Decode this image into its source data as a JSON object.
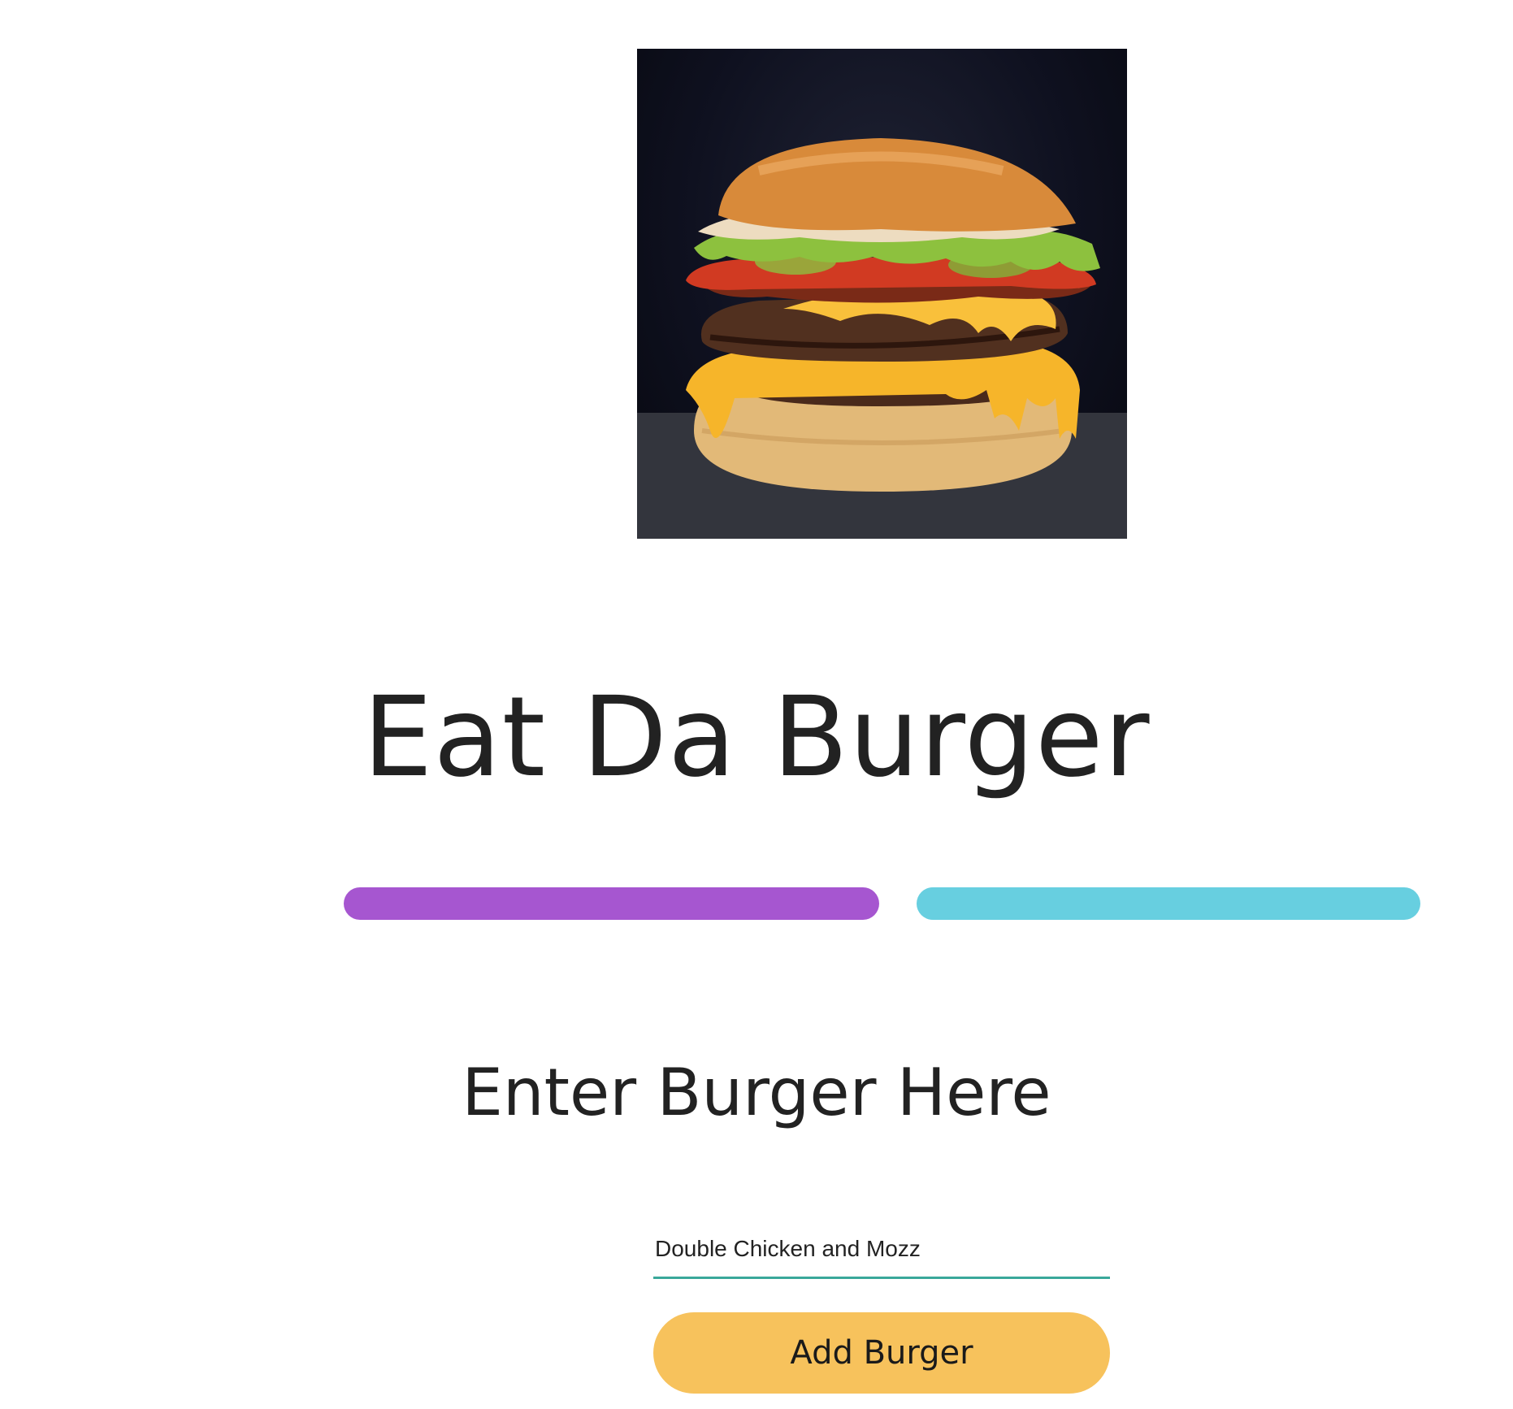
{
  "hero": {
    "image_subject": "cheeseburger"
  },
  "title": "Eat Da Burger",
  "subtitle": "Enter Burger Here",
  "form": {
    "input_value": "Double Chicken and Mozz",
    "button_label": "Add Burger"
  },
  "colors": {
    "bar_left": "#a656d0",
    "bar_right": "#67cfe0",
    "input_underline": "#3aa89a",
    "button_bg": "#f7c25c",
    "text": "#222222"
  }
}
